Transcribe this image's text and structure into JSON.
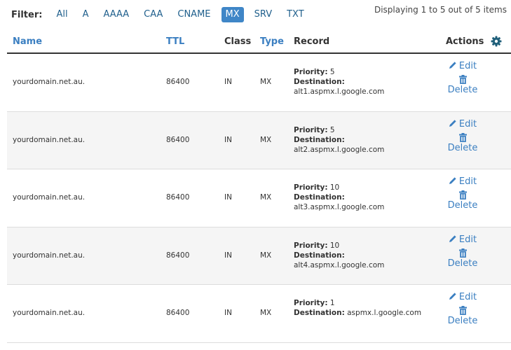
{
  "filter": {
    "label": "Filter:",
    "options": [
      "All",
      "A",
      "AAAA",
      "CAA",
      "CNAME",
      "MX",
      "SRV",
      "TXT"
    ],
    "active": "MX"
  },
  "display_info": "Displaying 1 to 5 out of 5 items",
  "columns": {
    "name": "Name",
    "ttl": "TTL",
    "class": "Class",
    "type": "Type",
    "record": "Record",
    "actions": "Actions"
  },
  "record_labels": {
    "priority": "Priority:",
    "destination": "Destination:"
  },
  "action_labels": {
    "edit": "Edit",
    "delete": "Delete"
  },
  "rows": [
    {
      "name": "yourdomain.net.au.",
      "ttl": "86400",
      "class": "IN",
      "type": "MX",
      "priority": "5",
      "destination": "alt1.aspmx.l.google.com"
    },
    {
      "name": "yourdomain.net.au.",
      "ttl": "86400",
      "class": "IN",
      "type": "MX",
      "priority": "5",
      "destination": "alt2.aspmx.l.google.com"
    },
    {
      "name": "yourdomain.net.au.",
      "ttl": "86400",
      "class": "IN",
      "type": "MX",
      "priority": "10",
      "destination": "alt3.aspmx.l.google.com"
    },
    {
      "name": "yourdomain.net.au.",
      "ttl": "86400",
      "class": "IN",
      "type": "MX",
      "priority": "10",
      "destination": "alt4.aspmx.l.google.com"
    },
    {
      "name": "yourdomain.net.au.",
      "ttl": "86400",
      "class": "IN",
      "type": "MX",
      "priority": "1",
      "destination": "aspmx.l.google.com"
    }
  ],
  "colors": {
    "link": "#3b7fc1",
    "active_filter_bg": "#3f86c7",
    "gear": "#1f5f7a"
  }
}
